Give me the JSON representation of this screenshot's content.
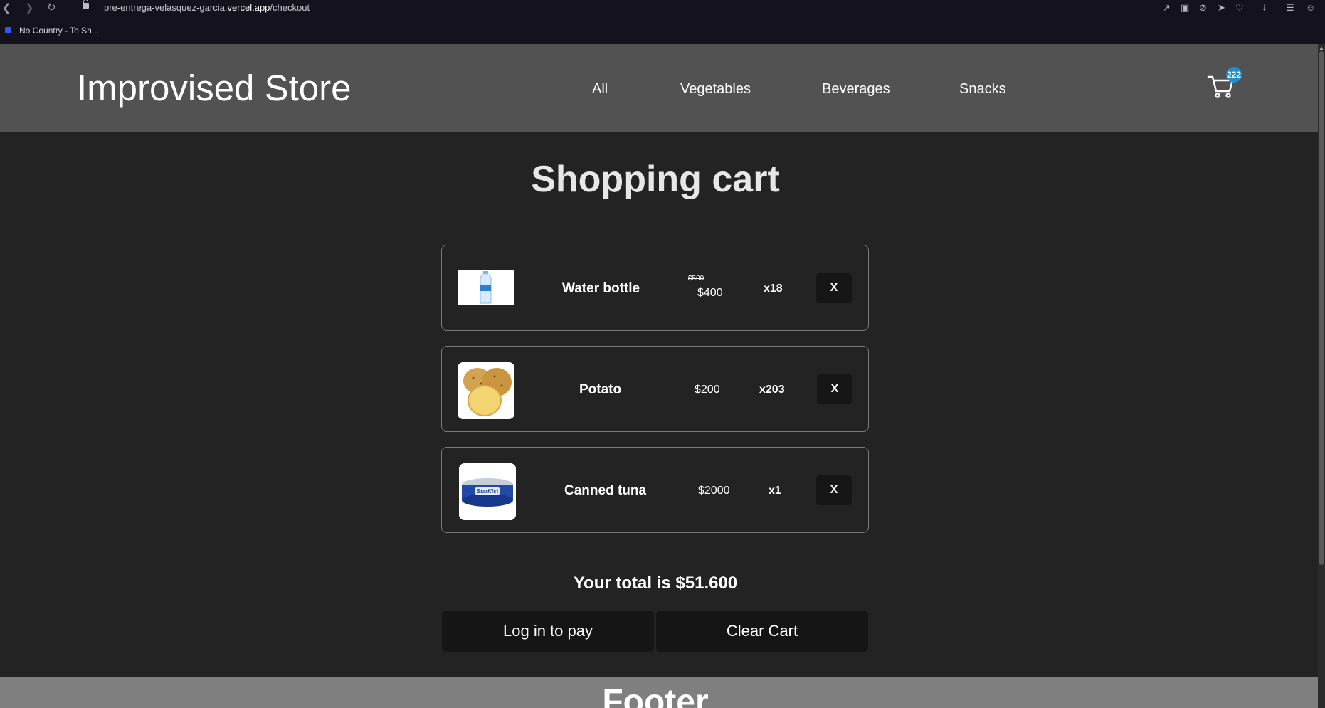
{
  "browser": {
    "url_prefix": "pre-entrega-velasquez-garcia.",
    "url_domain": "vercel.app",
    "url_path": "/checkout",
    "bookmark_label": "No Country - To Sh..."
  },
  "header": {
    "brand": "Improvised Store",
    "nav": [
      "All",
      "Vegetables",
      "Beverages",
      "Snacks"
    ],
    "cart_count": "222"
  },
  "main": {
    "title": "Shopping cart",
    "items": [
      {
        "name": "Water bottle",
        "old_price": "$500",
        "price": "$400",
        "qty": "x18",
        "remove_label": "X"
      },
      {
        "name": "Potato",
        "price": "$200",
        "qty": "x203",
        "remove_label": "X"
      },
      {
        "name": "Canned tuna",
        "price": "$2000",
        "qty": "x1",
        "remove_label": "X"
      }
    ],
    "total": "Your total is $51.600",
    "login_button": "Log in to pay",
    "clear_button": "Clear Cart"
  },
  "footer": {
    "title": "Footer"
  },
  "colors": {
    "header_bg": "#525252",
    "page_bg": "#232323",
    "badge": "#1d8fd2",
    "footer_bg": "#7f7f7f"
  }
}
